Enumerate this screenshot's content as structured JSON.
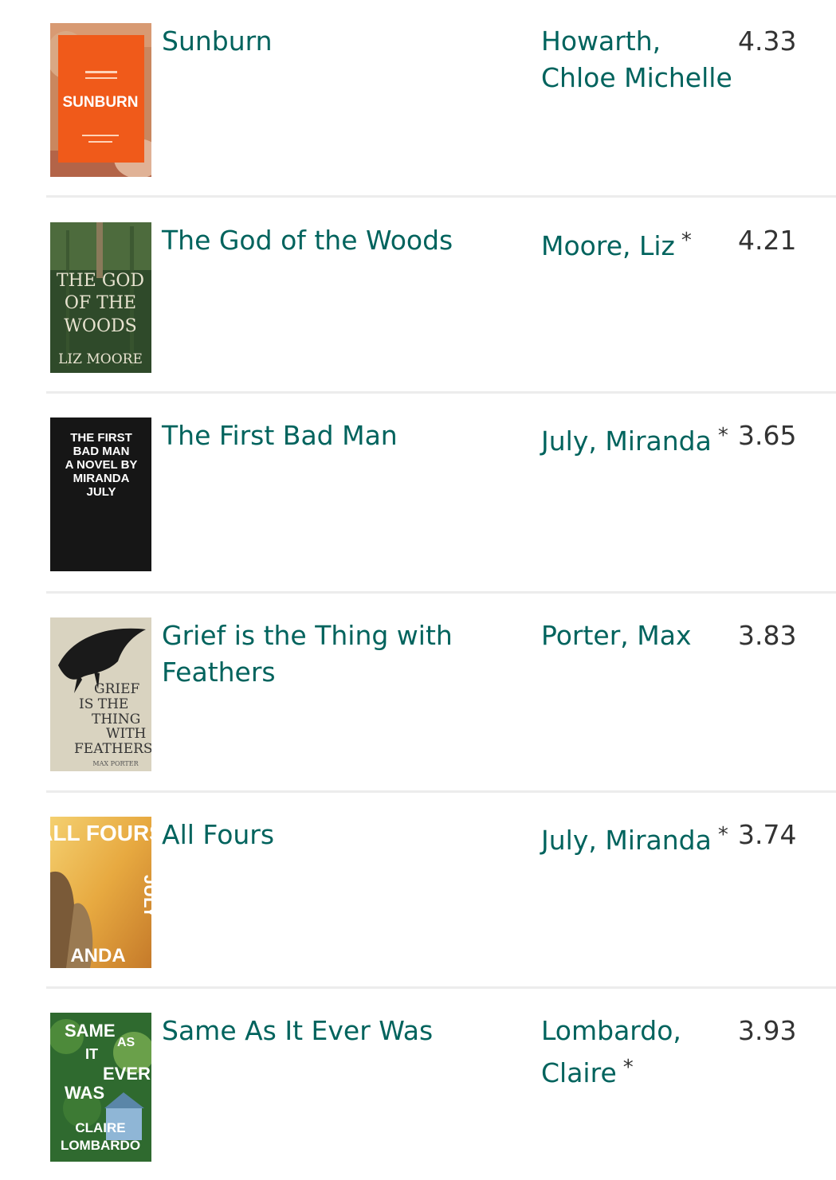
{
  "books": [
    {
      "title": "Sunburn",
      "author": "Howarth, Chloe Michelle",
      "author_line1": "Howarth,",
      "author_line2": "Chloe Michelle",
      "author_star": "",
      "rating": "4.33",
      "cover": {
        "icon": "book-cover-sunburn",
        "text": "SUNBURN",
        "colors": [
          "#f05a1a",
          "#b8552e"
        ]
      }
    },
    {
      "title": "The God of the Woods",
      "author": "Moore, Liz",
      "author_line1": "Moore, Liz",
      "author_line2": "",
      "author_star": "*",
      "rating": "4.21",
      "cover": {
        "icon": "book-cover-god-of-the-woods",
        "text": "THE GOD OF THE WOODS LIZ MOORE",
        "colors": [
          "#2f4a2a",
          "#4d6b3d"
        ]
      }
    },
    {
      "title": "The First Bad Man",
      "author": "July, Miranda",
      "author_line1": "July, Miranda",
      "author_line2": "",
      "author_star": "*",
      "rating": "3.65",
      "cover": {
        "icon": "book-cover-first-bad-man",
        "text": "THE FIRST BAD MAN A NOVEL BY MIRANDA JULY",
        "colors": [
          "#161616",
          "#ffffff"
        ]
      }
    },
    {
      "title": "Grief is the Thing with Feathers",
      "title_line1": "Grief is the Thing with",
      "title_line2": "Feathers",
      "author": "Porter, Max",
      "author_line1": "Porter, Max",
      "author_line2": "",
      "author_star": "",
      "rating": "3.83",
      "cover": {
        "icon": "book-cover-grief-feathers",
        "text": "GRIEF IS THE THING WITH FEATHERS MAX PORTER",
        "colors": [
          "#d9d3c0",
          "#1a1a1a"
        ]
      }
    },
    {
      "title": "All Fours",
      "author": "July, Miranda",
      "author_line1": "July, Miranda",
      "author_line2": "",
      "author_star": "*",
      "rating": "3.74",
      "cover": {
        "icon": "book-cover-all-fours",
        "text": "ALL FOURS MIRANDA JULY",
        "colors": [
          "#e7b24a",
          "#8a6a3a"
        ]
      }
    },
    {
      "title": "Same As It Ever Was",
      "author": "Lombardo, Claire",
      "author_line1": "Lombardo,",
      "author_line2": "Claire",
      "author_star": "*",
      "rating": "3.93",
      "cover": {
        "icon": "book-cover-same-as-it-ever-was",
        "text": "SAME AS IT EVER WAS CLAIRE LOMBARDO",
        "colors": [
          "#2f6a2f",
          "#9cc97a"
        ]
      }
    }
  ]
}
